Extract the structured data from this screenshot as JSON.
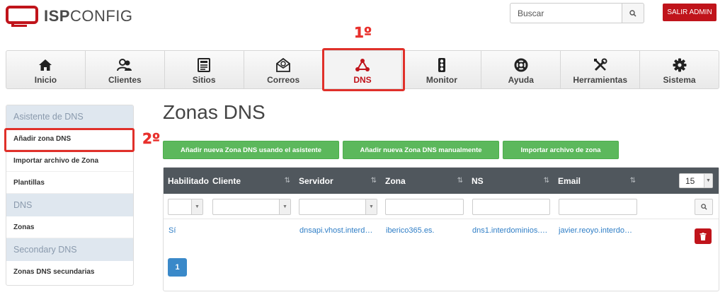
{
  "header": {
    "logo_bold": "ISP",
    "logo_light": "CONFIG",
    "search_placeholder": "Buscar",
    "logout_label": "SALIR ADMIN"
  },
  "annotations": {
    "step1": "1º",
    "step2": "2º",
    "color": "#e0302a"
  },
  "nav": {
    "items": [
      {
        "label": "Inicio",
        "icon": "home-icon"
      },
      {
        "label": "Clientes",
        "icon": "users-icon"
      },
      {
        "label": "Sitios",
        "icon": "sites-icon"
      },
      {
        "label": "Correos",
        "icon": "mail-icon"
      },
      {
        "label": "DNS",
        "icon": "dns-icon",
        "active": true
      },
      {
        "label": "Monitor",
        "icon": "traffic-light-icon"
      },
      {
        "label": "Ayuda",
        "icon": "lifebuoy-icon"
      },
      {
        "label": "Herramientas",
        "icon": "tools-icon"
      },
      {
        "label": "Sistema",
        "icon": "gear-icon"
      }
    ]
  },
  "sidebar": {
    "section1": "Asistente de DNS",
    "item_add_zone": "Añadir zona DNS",
    "item_import": "Importar archivo de Zona",
    "item_templates": "Plantillas",
    "section2": "DNS",
    "item_zones": "Zonas",
    "section3": "Secondary DNS",
    "item_secondary": "Zonas DNS secundarias"
  },
  "main": {
    "title": "Zonas DNS",
    "btn_wizard": "Añadir nueva Zona DNS usando el asistente",
    "btn_manual": "Añadir nueva Zona DNS manualmente",
    "btn_import": "Importar archivo de zona"
  },
  "table": {
    "col_enabled": "Habilitado",
    "col_client": "Cliente",
    "col_server": "Servidor",
    "col_zone": "Zona",
    "col_ns": "NS",
    "col_email": "Email",
    "sort_glyph": "⇅",
    "per_page": "15",
    "rows": [
      {
        "enabled": "Sí",
        "client": "",
        "server": "dnsapi.vhost.interd…",
        "zone": "iberico365.es.",
        "ns": "dns1.interdominios.…",
        "email": "javier.reoyo.interdo…"
      }
    ],
    "current_page": "1"
  },
  "colors": {
    "brand_red": "#c0141b",
    "green": "#5cb85c",
    "header_dark": "#50575d",
    "link_blue": "#2f7ec6",
    "pager_blue": "#3a89c9"
  }
}
